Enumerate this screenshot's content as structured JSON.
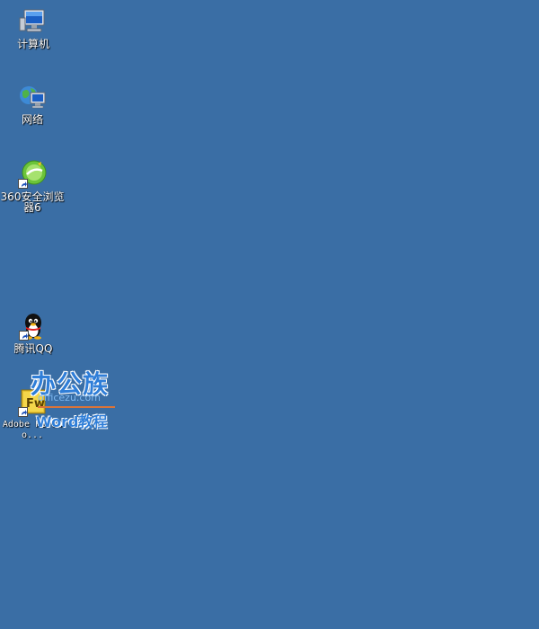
{
  "desktop": {
    "background_color": "#3a6ea5",
    "icons": [
      {
        "label": "计算机",
        "icon": "computer-icon"
      },
      {
        "label": "网络",
        "icon": "network-icon"
      },
      {
        "label": "360安全浏览器6",
        "icon": "360-browser-icon"
      },
      {
        "label": "腾讯QQ",
        "icon": "qq-penguin-icon"
      },
      {
        "label": "Adobe Firewo...",
        "icon": "adobe-fireworks-icon"
      }
    ]
  },
  "watermark": {
    "main": "办公族",
    "site": "officezu.com",
    "sub": "Word教程"
  }
}
